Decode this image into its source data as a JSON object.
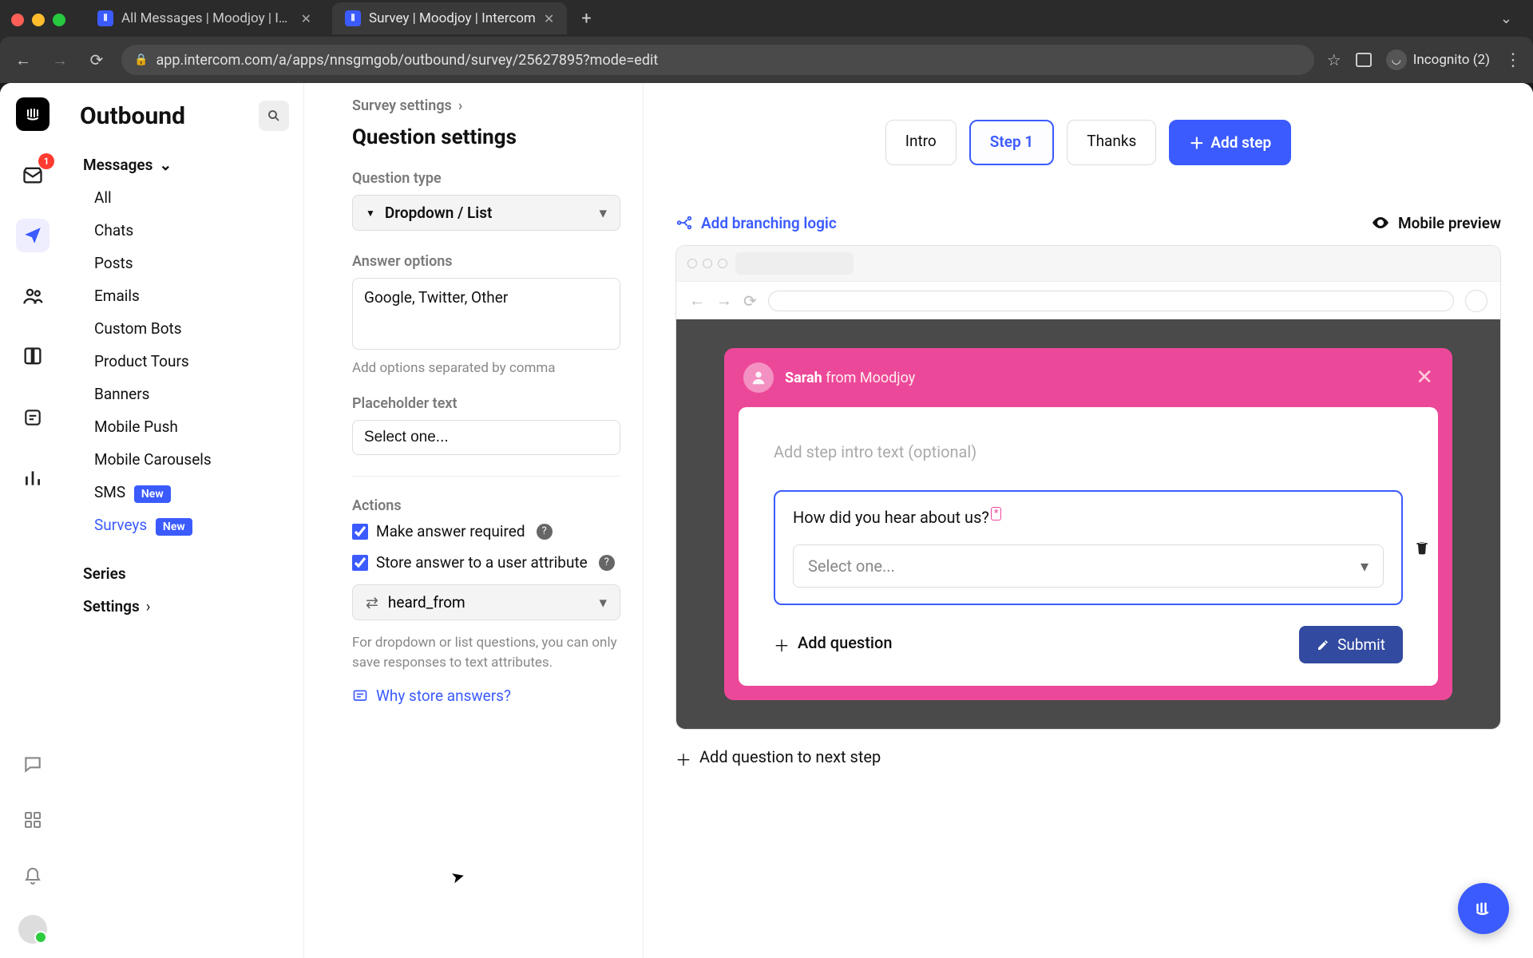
{
  "browser": {
    "tabs": [
      {
        "title": "All Messages | Moodjoy | Interc",
        "active": false
      },
      {
        "title": "Survey | Moodjoy | Intercom",
        "active": true
      }
    ],
    "url": "app.intercom.com/a/apps/nnsgmgob/outbound/survey/25627895?mode=edit",
    "incognito_label": "Incognito (2)"
  },
  "rail": {
    "inbox_badge": "1"
  },
  "sidebar": {
    "title": "Outbound",
    "messages_label": "Messages",
    "items": [
      "All",
      "Chats",
      "Posts",
      "Emails",
      "Custom Bots",
      "Product Tours",
      "Banners",
      "Mobile Push",
      "Mobile Carousels"
    ],
    "sms_label": "SMS",
    "surveys_label": "Surveys",
    "new_badge": "New",
    "series_label": "Series",
    "settings_label": "Settings"
  },
  "settings": {
    "breadcrumb": "Survey settings",
    "title": "Question settings",
    "qtype_label": "Question type",
    "qtype_value": "Dropdown / List",
    "answer_options_label": "Answer options",
    "answer_options_value": "Google, Twitter, Other",
    "answer_options_hint": "Add options separated by comma",
    "placeholder_label": "Placeholder text",
    "placeholder_value": "Select one...",
    "actions_label": "Actions",
    "required_label": "Make answer required",
    "store_label": "Store answer to a user attribute",
    "attribute_value": "heard_from",
    "attribute_note": "For dropdown or list questions, you can only save responses to text attributes.",
    "why_store": "Why store answers?"
  },
  "canvas": {
    "steps": {
      "intro": "Intro",
      "step1": "Step 1",
      "thanks": "Thanks",
      "add": "Add step"
    },
    "branching_label": "Add branching logic",
    "mobile_preview_label": "Mobile preview",
    "survey": {
      "author_name": "Sarah",
      "author_suffix": " from Moodjoy",
      "intro_placeholder": "Add step intro text (optional)",
      "question_text": "How did you hear about us?",
      "required_mark": "*",
      "select_placeholder": "Select one...",
      "add_question": "Add question",
      "submit": "Submit"
    },
    "add_next_step": "Add question to next step"
  }
}
